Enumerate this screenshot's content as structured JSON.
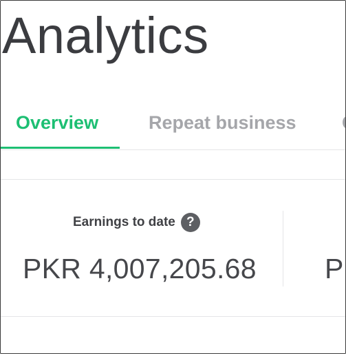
{
  "header": {
    "title": "Analytics"
  },
  "tabs": [
    {
      "label": "Overview",
      "active": true
    },
    {
      "label": "Repeat business",
      "active": false
    },
    {
      "label": "C",
      "active": false
    }
  ],
  "stats": [
    {
      "label": "Earnings to date",
      "help": "?",
      "value": "PKR 4,007,205.68"
    },
    {
      "value_partial": "PI"
    }
  ],
  "colors": {
    "accent": "#1dbf73",
    "inactive_tab": "#a5a6aa",
    "text": "#404145",
    "border": "#e4e5e7",
    "help_icon_bg": "#5d5f63"
  },
  "icons": {
    "help": "question-circle-icon"
  }
}
